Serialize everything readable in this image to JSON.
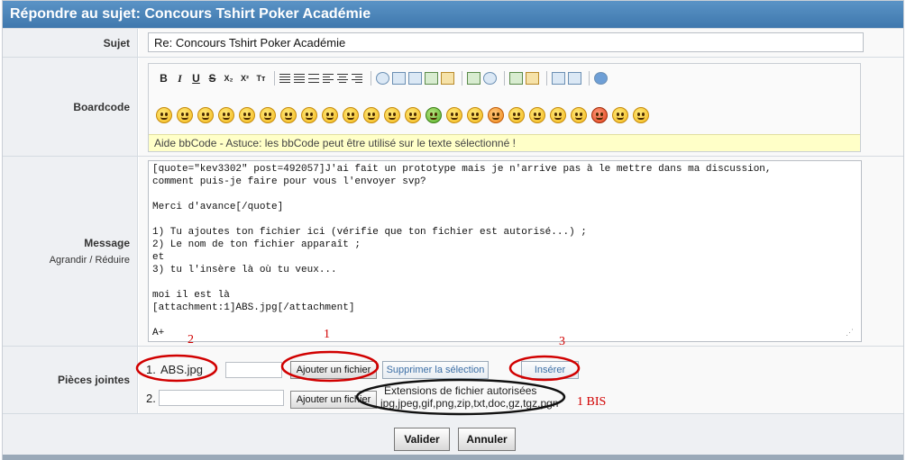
{
  "header": {
    "title": "Répondre au sujet: Concours Tshirt Poker Académie"
  },
  "subject": {
    "label": "Sujet",
    "value": "Re: Concours Tshirt Poker Académie"
  },
  "boardcode": {
    "label": "Boardcode",
    "format_buttons": [
      "B",
      "I",
      "U",
      "S",
      "X₂",
      "X²",
      "Tт"
    ],
    "help_text": "Aide bbCode - Astuce: les bbCode peut être utilisé sur le texte sélectionné !"
  },
  "message": {
    "label": "Message",
    "enlarge": "Agrandir /",
    "reduce": "Réduire",
    "text": "[quote=\"kev3302\" post=492057]J'ai fait un prototype mais je n'arrive pas à le mettre dans ma discussion,\ncomment puis-je faire pour vous l'envoyer svp?\n\nMerci d'avance[/quote]\n\n1) Tu ajoutes ton fichier ici (vérifie que ton fichier est autorisé...) ;\n2) Le nom de ton fichier apparaît ;\net\n3) tu l'insère là où tu veux...\n\nmoi il est là\n[attachment:1]ABS.jpg[/attachment]\n\nA+"
  },
  "attachments": {
    "label": "Pièces jointes",
    "row1": {
      "number": "1.",
      "filename": "ABS.jpg",
      "add": "Ajouter un fichier",
      "delete": "Supprimer la sélection",
      "insert": "Insérer"
    },
    "row2": {
      "number": "2.",
      "filename": "",
      "add": "Ajouter un fichier"
    },
    "extensions_title": "Extensions de fichier autorisées",
    "extensions_list": "jpg,jpeg,gif,png,zip,txt,doc,gz,tgz,pgn"
  },
  "annotations": {
    "one": "1",
    "two": "2",
    "three": "3",
    "one_bis": "1 BIS"
  },
  "buttons": {
    "submit": "Valider",
    "cancel": "Annuler"
  }
}
